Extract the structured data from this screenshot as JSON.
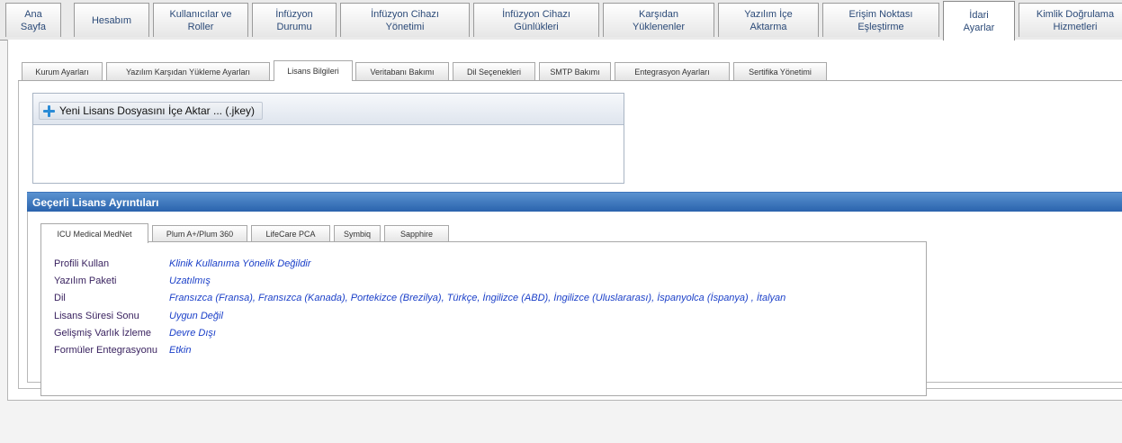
{
  "top_nav": {
    "tabs": [
      {
        "label": "Ana\nSayfa"
      },
      {
        "label": "Hesabım"
      },
      {
        "label": "Kullanıcılar ve\nRoller"
      },
      {
        "label": "İnfüzyon\nDurumu"
      },
      {
        "label": "İnfüzyon Cihazı\nYönetimi"
      },
      {
        "label": "İnfüzyon Cihazı\nGünlükleri"
      },
      {
        "label": "Karşıdan\nYüklenenler"
      },
      {
        "label": "Yazılım İçe\nAktarma"
      },
      {
        "label": "Erişim Noktası\nEşleştirme"
      },
      {
        "label": "İdari\nAyarlar"
      },
      {
        "label": "Kimlik Doğrulama\nHizmetleri"
      }
    ],
    "active": "İdari Ayarlar"
  },
  "sub_tabs": {
    "tabs": [
      {
        "label": "Kurum Ayarları"
      },
      {
        "label": "Yazılım Karşıdan Yükleme Ayarları"
      },
      {
        "label": "Lisans Bilgileri"
      },
      {
        "label": "Veritabanı Bakımı"
      },
      {
        "label": "Dil Seçenekleri"
      },
      {
        "label": "SMTP Bakımı"
      },
      {
        "label": "Entegrasyon Ayarları"
      },
      {
        "label": "Sertifika Yönetimi"
      }
    ],
    "active": "Lisans Bilgileri"
  },
  "import": {
    "button_label": "Yeni Lisans Dosyasını İçe Aktar ... (.jkey)",
    "icon": "plus-icon"
  },
  "details": {
    "title": "Geçerli Lisans Ayrıntıları",
    "tabs": [
      {
        "label": "ICU Medical MedNet"
      },
      {
        "label": "Plum A+/Plum 360"
      },
      {
        "label": "LifeCare PCA"
      },
      {
        "label": "Symbiq"
      },
      {
        "label": "Sapphire"
      }
    ],
    "active": "ICU Medical MedNet",
    "properties": [
      {
        "label": "Profili Kullan",
        "value": "Klinik Kullanıma Yönelik Değildir"
      },
      {
        "label": "Yazılım Paketi",
        "value": "Uzatılmış"
      },
      {
        "label": "Dil",
        "value": "Fransızca (Fransa), Fransızca (Kanada), Portekizce (Brezilya), Türkçe, İngilizce (ABD), İngilizce (Uluslararası), İspanyolca (İspanya) , İtalyan"
      },
      {
        "label": "Lisans Süresi Sonu",
        "value": "Uygun Değil"
      },
      {
        "label": "Gelişmiş Varlık İzleme",
        "value": "Devre Dışı"
      },
      {
        "label": "Formüler Entegrasyonu",
        "value": "Etkin"
      }
    ]
  },
  "colors": {
    "header_bar": "#2a63ad",
    "value_text": "#1a3fc8",
    "label_text": "#3a2360"
  }
}
